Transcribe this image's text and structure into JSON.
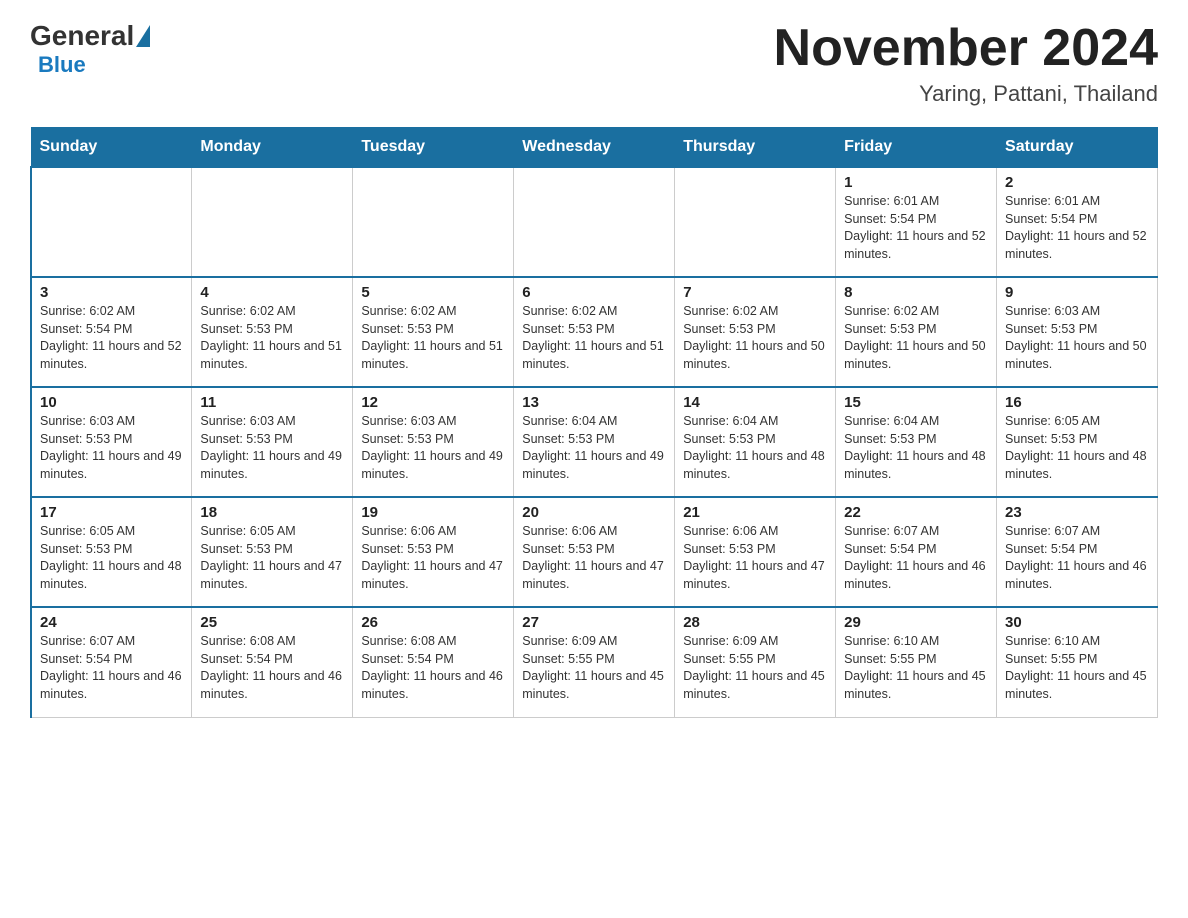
{
  "header": {
    "logo_general": "General",
    "logo_blue": "Blue",
    "month_title": "November 2024",
    "location": "Yaring, Pattani, Thailand"
  },
  "weekdays": [
    "Sunday",
    "Monday",
    "Tuesday",
    "Wednesday",
    "Thursday",
    "Friday",
    "Saturday"
  ],
  "weeks": [
    [
      {
        "day": "",
        "info": ""
      },
      {
        "day": "",
        "info": ""
      },
      {
        "day": "",
        "info": ""
      },
      {
        "day": "",
        "info": ""
      },
      {
        "day": "",
        "info": ""
      },
      {
        "day": "1",
        "info": "Sunrise: 6:01 AM\nSunset: 5:54 PM\nDaylight: 11 hours and 52 minutes."
      },
      {
        "day": "2",
        "info": "Sunrise: 6:01 AM\nSunset: 5:54 PM\nDaylight: 11 hours and 52 minutes."
      }
    ],
    [
      {
        "day": "3",
        "info": "Sunrise: 6:02 AM\nSunset: 5:54 PM\nDaylight: 11 hours and 52 minutes."
      },
      {
        "day": "4",
        "info": "Sunrise: 6:02 AM\nSunset: 5:53 PM\nDaylight: 11 hours and 51 minutes."
      },
      {
        "day": "5",
        "info": "Sunrise: 6:02 AM\nSunset: 5:53 PM\nDaylight: 11 hours and 51 minutes."
      },
      {
        "day": "6",
        "info": "Sunrise: 6:02 AM\nSunset: 5:53 PM\nDaylight: 11 hours and 51 minutes."
      },
      {
        "day": "7",
        "info": "Sunrise: 6:02 AM\nSunset: 5:53 PM\nDaylight: 11 hours and 50 minutes."
      },
      {
        "day": "8",
        "info": "Sunrise: 6:02 AM\nSunset: 5:53 PM\nDaylight: 11 hours and 50 minutes."
      },
      {
        "day": "9",
        "info": "Sunrise: 6:03 AM\nSunset: 5:53 PM\nDaylight: 11 hours and 50 minutes."
      }
    ],
    [
      {
        "day": "10",
        "info": "Sunrise: 6:03 AM\nSunset: 5:53 PM\nDaylight: 11 hours and 49 minutes."
      },
      {
        "day": "11",
        "info": "Sunrise: 6:03 AM\nSunset: 5:53 PM\nDaylight: 11 hours and 49 minutes."
      },
      {
        "day": "12",
        "info": "Sunrise: 6:03 AM\nSunset: 5:53 PM\nDaylight: 11 hours and 49 minutes."
      },
      {
        "day": "13",
        "info": "Sunrise: 6:04 AM\nSunset: 5:53 PM\nDaylight: 11 hours and 49 minutes."
      },
      {
        "day": "14",
        "info": "Sunrise: 6:04 AM\nSunset: 5:53 PM\nDaylight: 11 hours and 48 minutes."
      },
      {
        "day": "15",
        "info": "Sunrise: 6:04 AM\nSunset: 5:53 PM\nDaylight: 11 hours and 48 minutes."
      },
      {
        "day": "16",
        "info": "Sunrise: 6:05 AM\nSunset: 5:53 PM\nDaylight: 11 hours and 48 minutes."
      }
    ],
    [
      {
        "day": "17",
        "info": "Sunrise: 6:05 AM\nSunset: 5:53 PM\nDaylight: 11 hours and 48 minutes."
      },
      {
        "day": "18",
        "info": "Sunrise: 6:05 AM\nSunset: 5:53 PM\nDaylight: 11 hours and 47 minutes."
      },
      {
        "day": "19",
        "info": "Sunrise: 6:06 AM\nSunset: 5:53 PM\nDaylight: 11 hours and 47 minutes."
      },
      {
        "day": "20",
        "info": "Sunrise: 6:06 AM\nSunset: 5:53 PM\nDaylight: 11 hours and 47 minutes."
      },
      {
        "day": "21",
        "info": "Sunrise: 6:06 AM\nSunset: 5:53 PM\nDaylight: 11 hours and 47 minutes."
      },
      {
        "day": "22",
        "info": "Sunrise: 6:07 AM\nSunset: 5:54 PM\nDaylight: 11 hours and 46 minutes."
      },
      {
        "day": "23",
        "info": "Sunrise: 6:07 AM\nSunset: 5:54 PM\nDaylight: 11 hours and 46 minutes."
      }
    ],
    [
      {
        "day": "24",
        "info": "Sunrise: 6:07 AM\nSunset: 5:54 PM\nDaylight: 11 hours and 46 minutes."
      },
      {
        "day": "25",
        "info": "Sunrise: 6:08 AM\nSunset: 5:54 PM\nDaylight: 11 hours and 46 minutes."
      },
      {
        "day": "26",
        "info": "Sunrise: 6:08 AM\nSunset: 5:54 PM\nDaylight: 11 hours and 46 minutes."
      },
      {
        "day": "27",
        "info": "Sunrise: 6:09 AM\nSunset: 5:55 PM\nDaylight: 11 hours and 45 minutes."
      },
      {
        "day": "28",
        "info": "Sunrise: 6:09 AM\nSunset: 5:55 PM\nDaylight: 11 hours and 45 minutes."
      },
      {
        "day": "29",
        "info": "Sunrise: 6:10 AM\nSunset: 5:55 PM\nDaylight: 11 hours and 45 minutes."
      },
      {
        "day": "30",
        "info": "Sunrise: 6:10 AM\nSunset: 5:55 PM\nDaylight: 11 hours and 45 minutes."
      }
    ]
  ]
}
